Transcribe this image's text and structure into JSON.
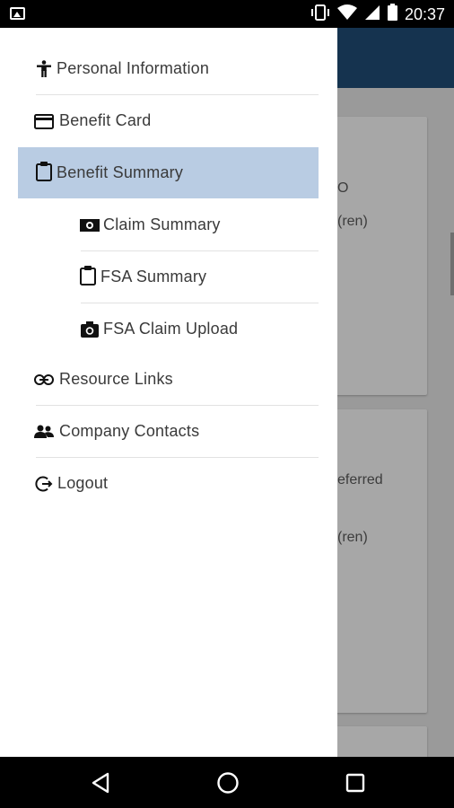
{
  "status_bar": {
    "time": "20:37",
    "icons": [
      "image-icon",
      "vibrate-icon",
      "wifi-icon",
      "signal-icon",
      "battery-icon"
    ]
  },
  "background": {
    "card_snippets": [
      "O",
      "(ren)",
      "eferred",
      "(ren)"
    ]
  },
  "drawer": {
    "items": [
      {
        "label": "Personal Information",
        "icon": "person-icon"
      },
      {
        "label": "Benefit Card",
        "icon": "credit-card-icon"
      },
      {
        "label": "Benefit Summary",
        "icon": "clipboard-icon",
        "selected": true
      },
      {
        "label": "Claim Summary",
        "icon": "money-icon"
      },
      {
        "label": "FSA Summary",
        "icon": "clipboard-icon"
      },
      {
        "label": "FSA Claim Upload",
        "icon": "camera-icon"
      },
      {
        "label": "Resource Links",
        "icon": "link-icon"
      },
      {
        "label": "Company Contacts",
        "icon": "contacts-icon"
      },
      {
        "label": "Logout",
        "icon": "logout-icon"
      }
    ]
  },
  "nav_bar": {
    "buttons": [
      "back-icon",
      "home-icon",
      "recents-icon"
    ]
  },
  "colors": {
    "selected_item_bg": "#b9cce3",
    "app_bar": "#15334f"
  }
}
